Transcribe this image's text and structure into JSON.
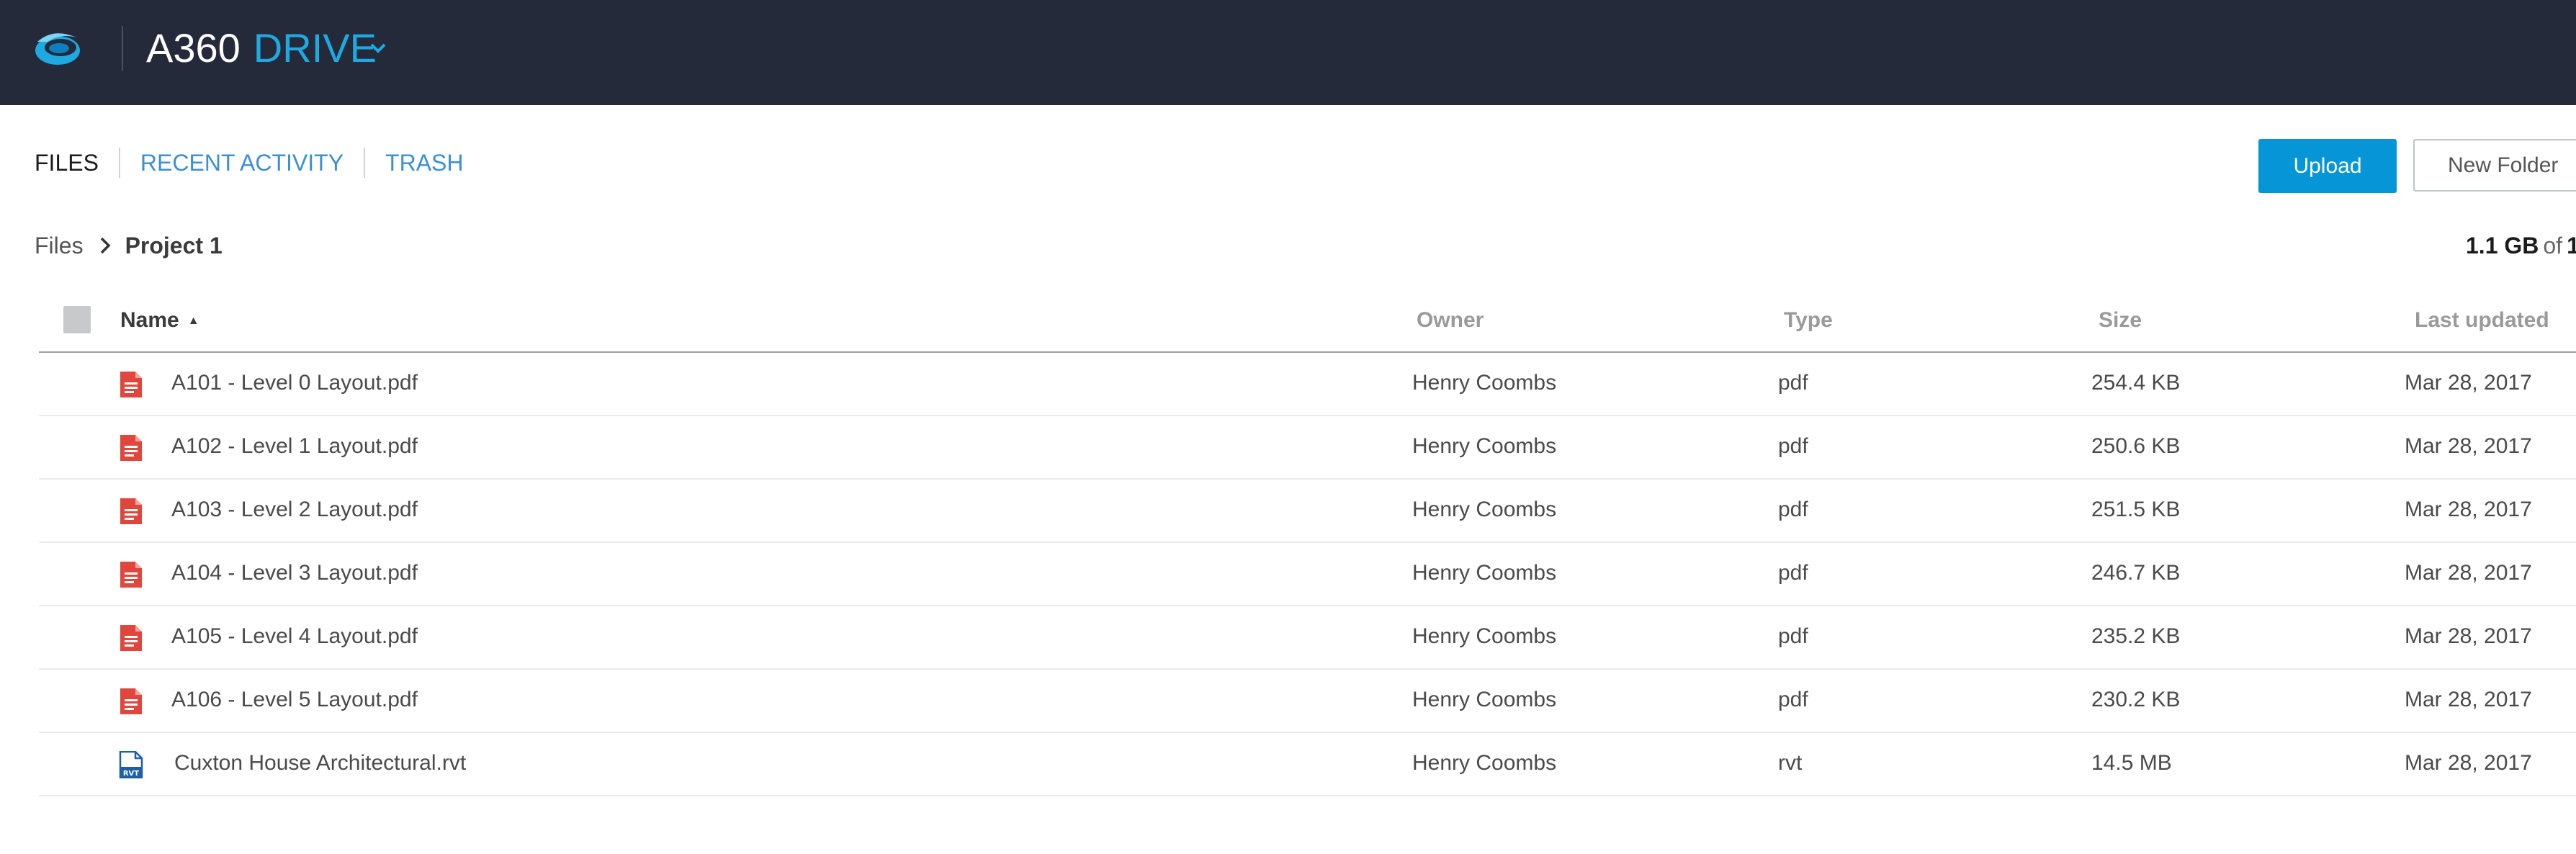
{
  "app": {
    "name": "A360",
    "product": "DRIVE",
    "logo_icon": "autodesk-a360-logo",
    "colors": {
      "header_bg": "#252a3b",
      "accent": "#1ea9e1",
      "primary_button": "#0696d7",
      "pdf_icon": "#e0463c",
      "rvt_icon": "#1f5fa8"
    }
  },
  "tabs": [
    {
      "label": "FILES",
      "active": true
    },
    {
      "label": "RECENT ACTIVITY",
      "active": false
    },
    {
      "label": "TRASH",
      "active": false
    }
  ],
  "actions": {
    "upload": "Upload",
    "new_folder": "New Folder"
  },
  "breadcrumb": {
    "root": "Files",
    "current": "Project 1"
  },
  "storage": {
    "used": "1.1 GB",
    "of": "of",
    "total": "1"
  },
  "table": {
    "columns": {
      "name": "Name",
      "owner": "Owner",
      "type": "Type",
      "size": "Size",
      "last_updated": "Last updated"
    },
    "sort": {
      "column": "Name",
      "direction": "ascending"
    },
    "rows": [
      {
        "name": "A101 - Level 0 Layout.pdf",
        "owner": "Henry Coombs",
        "type": "pdf",
        "size": "254.4 KB",
        "updated": "Mar 28, 2017",
        "icon": "pdf-file-icon"
      },
      {
        "name": "A102 - Level 1 Layout.pdf",
        "owner": "Henry Coombs",
        "type": "pdf",
        "size": "250.6 KB",
        "updated": "Mar 28, 2017",
        "icon": "pdf-file-icon"
      },
      {
        "name": "A103 - Level 2 Layout.pdf",
        "owner": "Henry Coombs",
        "type": "pdf",
        "size": "251.5 KB",
        "updated": "Mar 28, 2017",
        "icon": "pdf-file-icon"
      },
      {
        "name": "A104 - Level 3 Layout.pdf",
        "owner": "Henry Coombs",
        "type": "pdf",
        "size": "246.7 KB",
        "updated": "Mar 28, 2017",
        "icon": "pdf-file-icon"
      },
      {
        "name": "A105 - Level 4 Layout.pdf",
        "owner": "Henry Coombs",
        "type": "pdf",
        "size": "235.2 KB",
        "updated": "Mar 28, 2017",
        "icon": "pdf-file-icon"
      },
      {
        "name": "A106 - Level 5 Layout.pdf",
        "owner": "Henry Coombs",
        "type": "pdf",
        "size": "230.2 KB",
        "updated": "Mar 28, 2017",
        "icon": "pdf-file-icon"
      },
      {
        "name": "Cuxton House Architectural.rvt",
        "owner": "Henry Coombs",
        "type": "rvt",
        "size": "14.5 MB",
        "updated": "Mar 28, 2017",
        "icon": "rvt-file-icon",
        "icon_text": "RVT"
      }
    ]
  }
}
